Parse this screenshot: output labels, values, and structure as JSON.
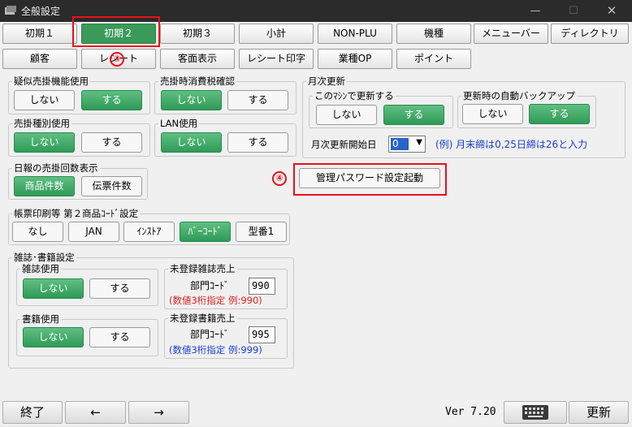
{
  "window": {
    "title": "全般設定",
    "minimize": "—",
    "maximize": "☐",
    "close": "✕"
  },
  "tabs_row1": [
    "初期１",
    "初期２",
    "初期３",
    "小計",
    "NON-PLU",
    "機種",
    "メニューバー",
    "ディレクトリ"
  ],
  "tabs_row2": [
    "顧客",
    "レシート",
    "客面表示",
    "レシート印字",
    "業種OP",
    "ポイント"
  ],
  "active_tab": "初期２",
  "callouts": {
    "c3": "③",
    "c4": "④"
  },
  "groups": {
    "pseudo_credit": {
      "label": "疑似売掛機能使用",
      "opt_no": "しない",
      "opt_yes": "する",
      "selected": "する"
    },
    "credit_tax": {
      "label": "売掛時消費税確認",
      "opt_no": "しない",
      "opt_yes": "する",
      "selected": "しない"
    },
    "credit_type": {
      "label": "売掛種別使用",
      "opt_no": "しない",
      "opt_yes": "する",
      "selected": "しない"
    },
    "lan": {
      "label": "LAN使用",
      "opt_no": "しない",
      "opt_yes": "する",
      "selected": "しない"
    },
    "daily_report": {
      "label": "日報の売掛回数表示",
      "opt_items": "商品件数",
      "opt_slips": "伝票件数",
      "selected": "商品件数"
    },
    "slip_print": {
      "label": "帳票印刷等 第２商品ｺｰﾄﾞ設定",
      "options": [
        "なし",
        "JAN",
        "ｲﾝｽﾄｱ",
        "ﾊﾞｰｺｰﾄﾞ",
        "型番1"
      ],
      "selected": "ﾊﾞｰｺｰﾄﾞ"
    },
    "monthly": {
      "label": "月次更新",
      "this_machine": {
        "label": "このﾏｼﾝで更新する",
        "opt_no": "しない",
        "opt_yes": "する",
        "selected": "する"
      },
      "auto_backup": {
        "label": "更新時の自動バックアップ",
        "opt_no": "しない",
        "opt_yes": "する",
        "selected": "する"
      },
      "start_day_label": "月次更新開始日",
      "start_day_value": "0",
      "hint": "(例) 月末締は0,25日締は26と入力"
    },
    "magazine_book": {
      "label": "雑誌･書籍設定",
      "magazine": {
        "label": "雑誌使用",
        "opt_no": "しない",
        "opt_yes": "する",
        "selected": "しない"
      },
      "book": {
        "label": "書籍使用",
        "opt_no": "しない",
        "opt_yes": "する",
        "selected": "しない"
      },
      "unreg_magazine": {
        "label": "未登録雑誌売上",
        "dept_label": "部門ｺｰﾄﾞ",
        "dept_value": "990",
        "note": "(数値3桁指定 例:990)"
      },
      "unreg_book": {
        "label": "未登録書籍売上",
        "dept_label": "部門ｺｰﾄﾞ",
        "dept_value": "995",
        "note": "(数値3桁指定 例:999)"
      }
    }
  },
  "admin_password_button": "管理パスワード設定起動",
  "bottom": {
    "exit": "終了",
    "prev": "←",
    "next": "→",
    "version": "Ver 7.20",
    "update": "更新"
  },
  "colors": {
    "selected_green": "#3a9a5a",
    "callout_red": "#e8101a",
    "hint_blue": "#1a3fc8",
    "note_red": "#d91e1e"
  }
}
